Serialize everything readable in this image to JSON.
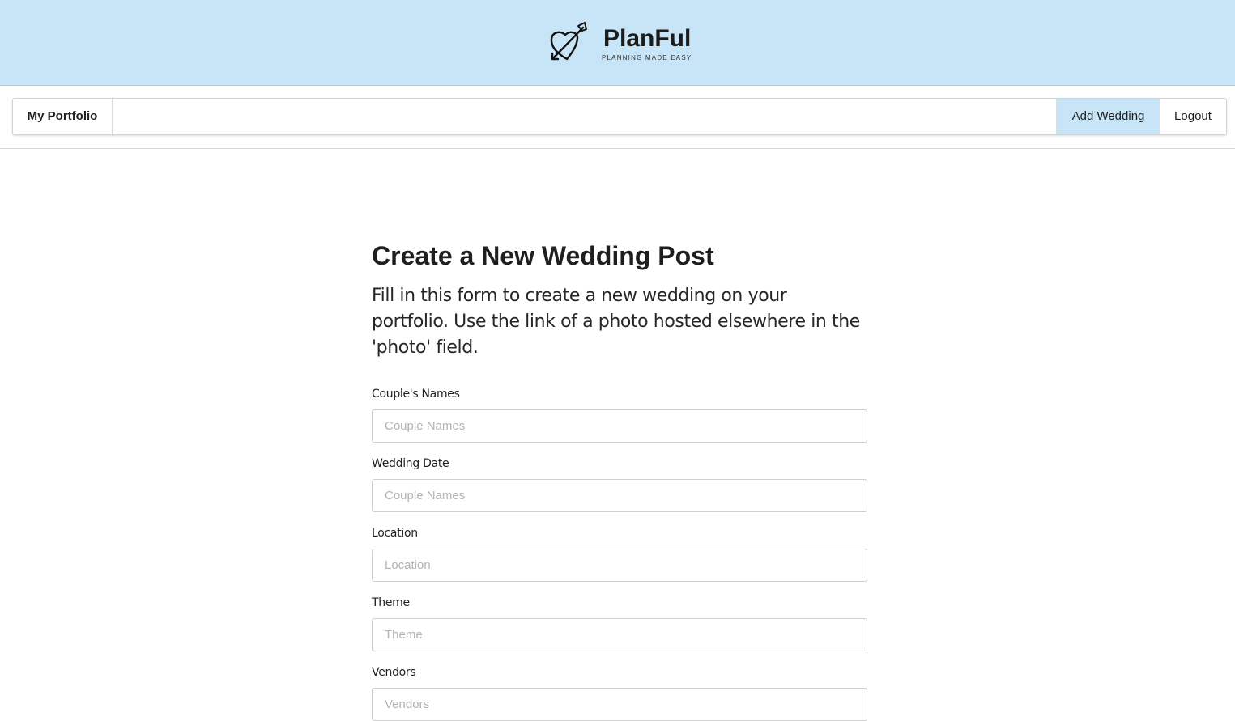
{
  "brand": {
    "name": "PlanFul",
    "tagline": "PLANNING MADE EASY",
    "logo_icon": "heart-arrow-icon",
    "header_color": "#c8e5f8"
  },
  "nav": {
    "portfolio_label": "My Portfolio",
    "add_wedding_label": "Add Wedding",
    "logout_label": "Logout",
    "active_item": "Add Wedding"
  },
  "form": {
    "title": "Create a New Wedding Post",
    "description": "Fill in this form to create a new wedding on your portfolio. Use the link of a photo hosted elsewhere in the 'photo' field.",
    "fields": [
      {
        "label": "Couple's Names",
        "placeholder": "Couple Names",
        "value": ""
      },
      {
        "label": "Wedding Date",
        "placeholder": "Couple Names",
        "value": ""
      },
      {
        "label": "Location",
        "placeholder": "Location",
        "value": ""
      },
      {
        "label": "Theme",
        "placeholder": "Theme",
        "value": ""
      },
      {
        "label": "Vendors",
        "placeholder": "Vendors",
        "value": ""
      }
    ]
  }
}
